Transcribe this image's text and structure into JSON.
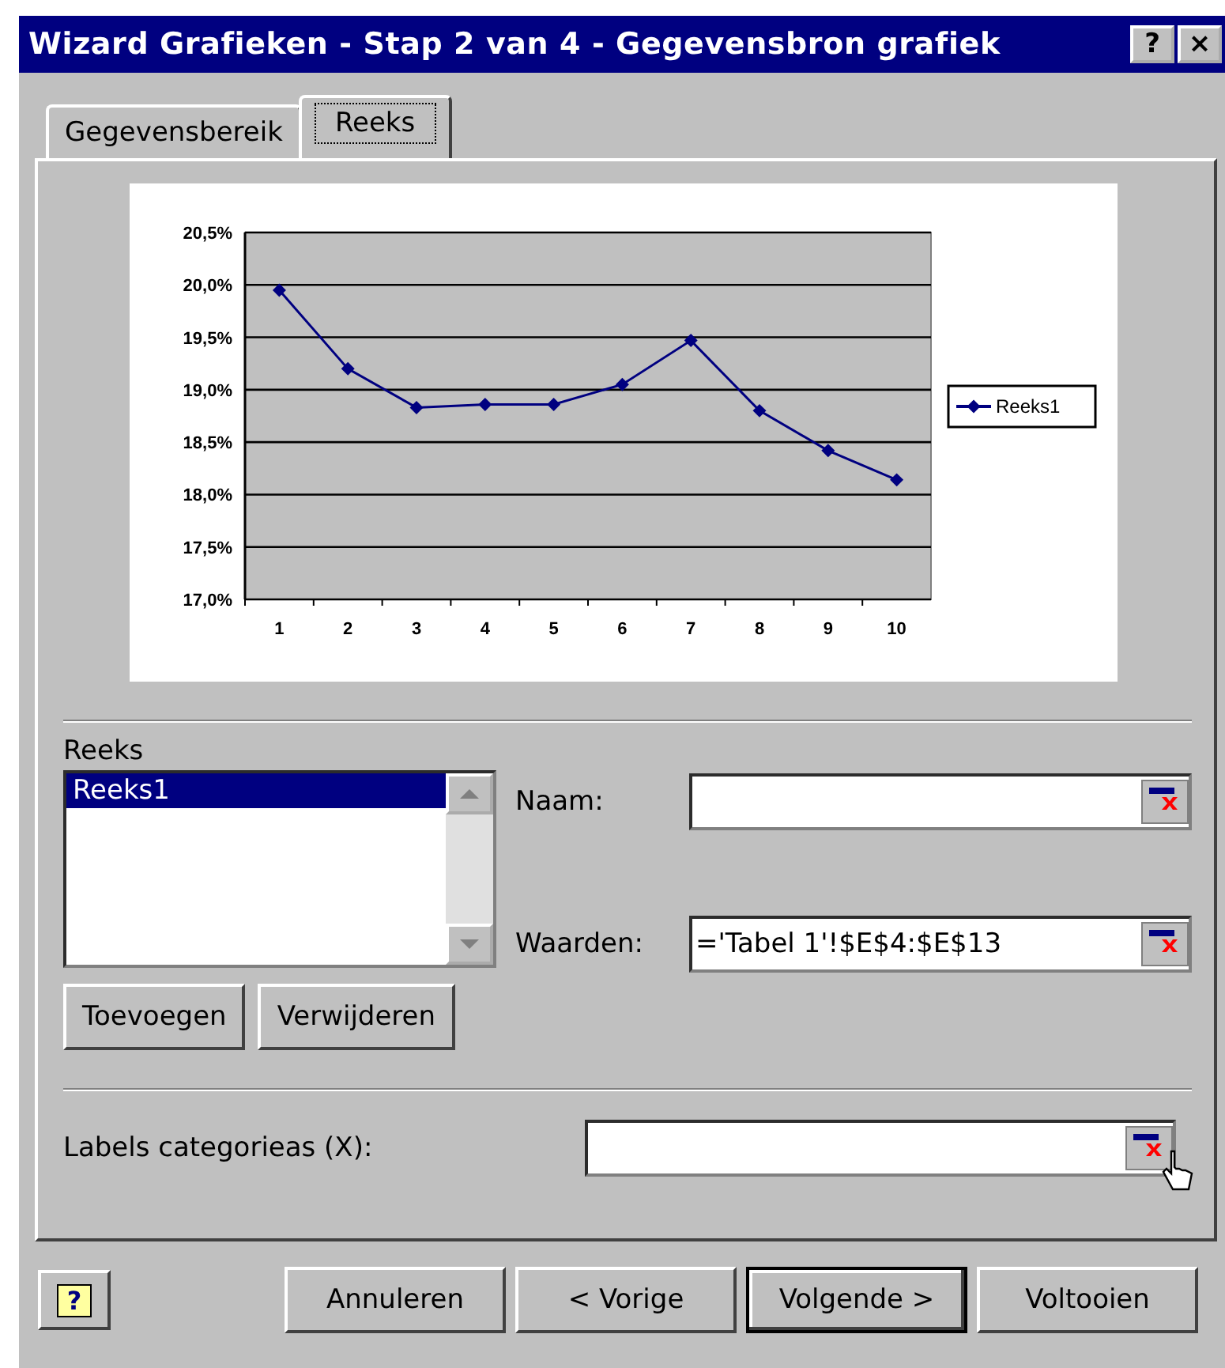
{
  "window": {
    "title": "Wizard Grafieken - Stap 2 van 4 - Gegevensbron grafiek",
    "help_button": "?",
    "close_button": "×"
  },
  "tabs": [
    {
      "label": "Gegevensbereik",
      "selected": false
    },
    {
      "label": "Reeks",
      "selected": true
    }
  ],
  "chart": {
    "chart_data": {
      "type": "line",
      "categories": [
        "1",
        "2",
        "3",
        "4",
        "5",
        "6",
        "7",
        "8",
        "9",
        "10"
      ],
      "grid": true,
      "series": [
        {
          "name": "Reeks1",
          "color": "#000080",
          "marker": "diamond",
          "values": [
            19.95,
            19.2,
            18.83,
            18.86,
            18.86,
            19.05,
            19.47,
            18.8,
            18.42,
            18.14
          ]
        }
      ],
      "ylim": [
        17,
        20.5
      ],
      "yticks": [
        {
          "value": 17,
          "label": "17,0%"
        },
        {
          "value": 17.5,
          "label": "17,5%"
        },
        {
          "value": 18,
          "label": "18,0%"
        },
        {
          "value": 18.5,
          "label": "18,5%"
        },
        {
          "value": 19,
          "label": "19,0%"
        },
        {
          "value": 19.5,
          "label": "19,5%"
        },
        {
          "value": 20,
          "label": "20,0%"
        },
        {
          "value": 20.5,
          "label": "20,5%"
        }
      ]
    }
  },
  "series_list": {
    "label": "Reeks",
    "items": [
      {
        "label": "Reeks1",
        "selected": true
      }
    ]
  },
  "series_buttons": [
    "Toevoegen",
    "Verwijderen"
  ],
  "fields": [
    {
      "label": "Naam:"
    },
    {
      "label": "Waarden:",
      "value": "='Tabel 1'!$E$4:$E$13"
    }
  ],
  "category_labels": {
    "label": "Labels categorieas (X):"
  },
  "help_icon": "?",
  "buttons": [
    {
      "label": "Annuleren",
      "default": false
    },
    {
      "label": "< Vorige",
      "default": false
    },
    {
      "label": "Volgende >",
      "default": true
    },
    {
      "label": "Voltooien",
      "default": false
    }
  ]
}
